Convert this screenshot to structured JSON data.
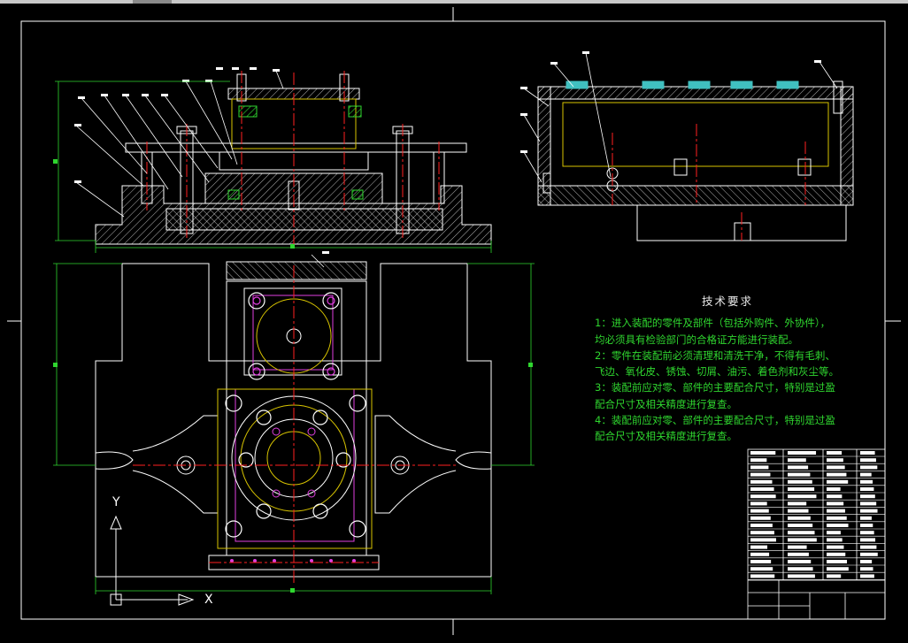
{
  "window": {
    "title": ""
  },
  "tech_requirements": {
    "title": "技术要求",
    "lines": [
      "1：进入装配的零件及部件（包括外购件、外协件），",
      "均必须具有检验部门的合格证方能进行装配。",
      "2：零件在装配前必须清理和清洗干净，不得有毛刺、",
      "飞边、氧化皮、锈蚀、切屑、油污、着色剂和灰尘等。",
      "3：装配前应对零、部件的主要配合尺寸，特别是过盈",
      "配合尺寸及相关精度进行复查。",
      "4：装配前应对零、部件的主要配合尺寸，特别是过盈",
      "配合尺寸及相关精度进行复查。"
    ]
  },
  "ucs": {
    "x_label": "X",
    "y_label": "Y"
  },
  "colors": {
    "background": "#000000",
    "outline": "#ffffff",
    "centerline": "#ff2020",
    "hidden": "#d8c400",
    "green": "#2fd62f",
    "magenta": "#e040e0",
    "cyan": "#40c0c0"
  }
}
